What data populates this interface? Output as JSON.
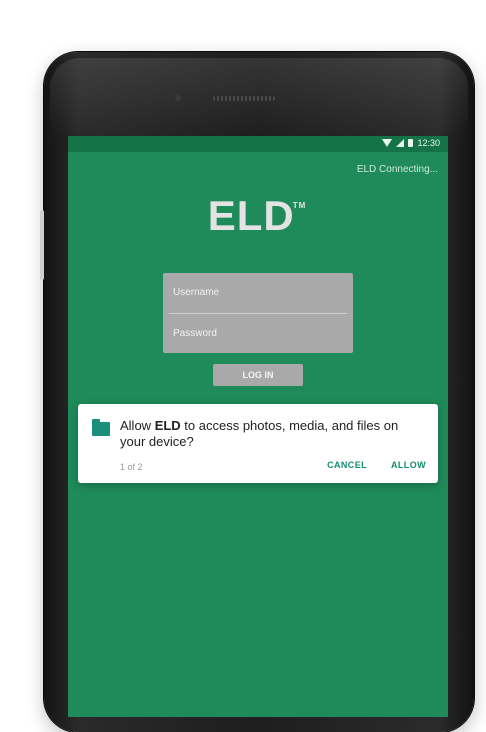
{
  "status_bar": {
    "time": "12:30",
    "connection_status": "ELD Connecting..."
  },
  "app": {
    "logo_text": "ELD",
    "logo_mark": "TM"
  },
  "login": {
    "username_placeholder": "Username",
    "password_placeholder": "Password",
    "login_button_label": "LOG IN"
  },
  "permission_dialog": {
    "message_prefix": "Allow ",
    "app_name": "ELD",
    "message_suffix": " to access photos, media, and files on your device?",
    "counter": "1 of 2",
    "deny_label": "CANCEL",
    "allow_label": "ALLOW",
    "icon": "folder-icon"
  },
  "colors": {
    "screen_green": "#1f8a5a",
    "status_green": "#157447",
    "accent": "#178c6e"
  }
}
